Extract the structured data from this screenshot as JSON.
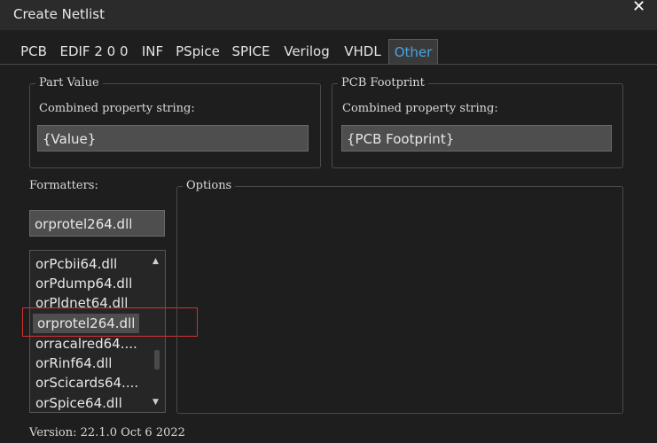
{
  "window": {
    "title": "Create Netlist",
    "close_glyph": "✕"
  },
  "tabs": [
    {
      "label": "PCB"
    },
    {
      "label": "EDIF 2 0 0"
    },
    {
      "label": "INF"
    },
    {
      "label": "PSpice"
    },
    {
      "label": "SPICE"
    },
    {
      "label": "Verilog"
    },
    {
      "label": "VHDL"
    },
    {
      "label": "Other",
      "active": true
    }
  ],
  "part_value": {
    "legend": "Part Value",
    "label": "Combined property string:",
    "value": "{Value}"
  },
  "pcb_footprint": {
    "legend": "PCB Footprint",
    "label": "Combined property string:",
    "value": "{PCB Footprint}"
  },
  "formatters": {
    "label": "Formatters:",
    "current": "orprotel264.dll",
    "items": [
      "orPcbii64.dll",
      "orPdump64.dll",
      "orPldnet64.dll",
      "orprotel264.dll",
      "orracalred64....",
      "orRinf64.dll",
      "orScicards64....",
      "orSpice64.dll"
    ],
    "selected": "orprotel264.dll",
    "scroll_up_glyph": "▲",
    "scroll_down_glyph": "▼"
  },
  "options": {
    "legend": "Options"
  },
  "version_text": "Version: 22.1.0  Oct  6 2022",
  "colors": {
    "accent": "#4aa3e0",
    "highlight": "#d63030"
  }
}
